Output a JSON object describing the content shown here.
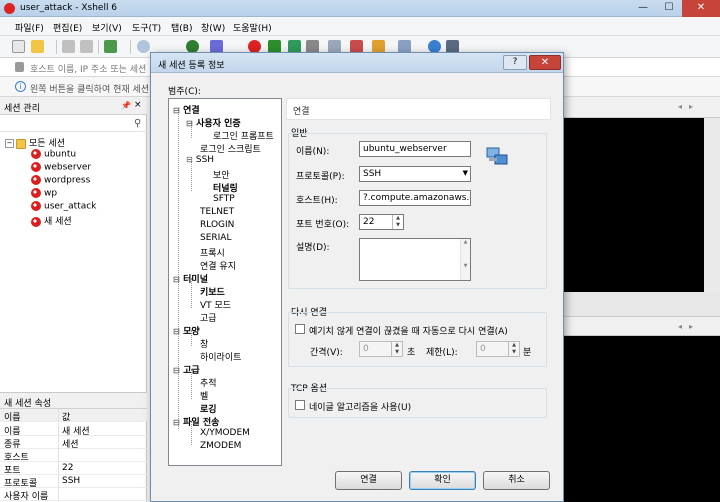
{
  "window": {
    "title": "user_attack - Xshell 6",
    "min_glyph": "—",
    "max_glyph": "☐",
    "close_glyph": "✕"
  },
  "menu": [
    "파일(F)",
    "편집(E)",
    "보기(V)",
    "도구(T)",
    "탭(B)",
    "창(W)",
    "도움말(H)"
  ],
  "address": {
    "placeholder": "호스트 이름, IP 주소 또는 세션"
  },
  "hint": {
    "text": "왼쪽 버튼을 클릭하여 현재 세션"
  },
  "session_panel": {
    "title": "세션 관리",
    "pin_glyph": "📌",
    "close_glyph": "×",
    "root": "모든 세션",
    "expander": "−",
    "items": [
      "ubuntu",
      "webserver",
      "wordpress",
      "wp",
      "user_attack",
      "새 세션"
    ]
  },
  "properties": {
    "title": "새 세션 속성",
    "header": {
      "key": "이름",
      "value": "값"
    },
    "rows": [
      {
        "key": "이름",
        "value": "새 세션"
      },
      {
        "key": "종류",
        "value": "세션"
      },
      {
        "key": "호스트",
        "value": ""
      },
      {
        "key": "포트",
        "value": "22"
      },
      {
        "key": "프로토콜",
        "value": "SSH"
      },
      {
        "key": "사용자 이름",
        "value": ""
      }
    ]
  },
  "tab_arrows": {
    "left": "◂",
    "right": "▸"
  },
  "dialog": {
    "title": "새 세션 등록 정보",
    "help": "?",
    "close": "✕",
    "category_label": "범주(C):",
    "categories": [
      {
        "id": "connection",
        "label": "연결",
        "bold": true,
        "mark": "⊟"
      },
      {
        "id": "user-auth",
        "label": "사용자 인증",
        "bold": true,
        "mark": "⊟"
      },
      {
        "id": "login-prompt",
        "label": "로그인 프롬프트"
      },
      {
        "id": "login-script",
        "label": "로그인 스크립트"
      },
      {
        "id": "ssh",
        "label": "SSH",
        "mark": "⊟"
      },
      {
        "id": "security",
        "label": "보안"
      },
      {
        "id": "tunneling",
        "label": "터널링",
        "bold": true
      },
      {
        "id": "sftp",
        "label": "SFTP"
      },
      {
        "id": "telnet",
        "label": "TELNET"
      },
      {
        "id": "rlogin",
        "label": "RLOGIN"
      },
      {
        "id": "serial",
        "label": "SERIAL"
      },
      {
        "id": "proxy",
        "label": "프록시"
      },
      {
        "id": "keepalive",
        "label": "연결 유지"
      },
      {
        "id": "terminal",
        "label": "터미널",
        "bold": true,
        "mark": "⊟"
      },
      {
        "id": "keyboard",
        "label": "키보드",
        "bold": true
      },
      {
        "id": "vt-mode",
        "label": "VT 모드"
      },
      {
        "id": "advanced-t",
        "label": "고급"
      },
      {
        "id": "appearance",
        "label": "모양",
        "bold": true,
        "mark": "⊟"
      },
      {
        "id": "window",
        "label": "창"
      },
      {
        "id": "highlight",
        "label": "하이라이트"
      },
      {
        "id": "advanced",
        "label": "고급",
        "bold": true,
        "mark": "⊟"
      },
      {
        "id": "trace",
        "label": "추적"
      },
      {
        "id": "bell",
        "label": "벨"
      },
      {
        "id": "logging",
        "label": "로깅",
        "bold": true
      },
      {
        "id": "file-transfer",
        "label": "파일 전송",
        "bold": true,
        "mark": "⊟"
      },
      {
        "id": "xymodem",
        "label": "X/YMODEM"
      },
      {
        "id": "zmodem",
        "label": "ZMODEM"
      }
    ],
    "content_header": "연결",
    "general": {
      "title": "일반",
      "name_label": "이름(N):",
      "name_value": "ubuntu_webserver",
      "protocol_label": "프로토콜(P):",
      "protocol_value": "SSH",
      "host_label": "호스트(H):",
      "host_value": "?.compute.amazonaws.com",
      "port_label": "포트 번호(O):",
      "port_value": "22",
      "desc_label": "설명(D):",
      "desc_value": ""
    },
    "reconnect": {
      "title": "다시 연결",
      "checkbox_label": "예기치 않게 연결이 끊겼을 때 자동으로 다시 연결(A)",
      "interval_label": "간격(V):",
      "interval_value": "0",
      "interval_unit": "초",
      "limit_label": "제한(L):",
      "limit_value": "0",
      "limit_unit": "분"
    },
    "tcp": {
      "title": "TCP 옵션",
      "checkbox_label": "네이글 알고리즘을 사용(U)"
    },
    "buttons": {
      "connect": "연결",
      "ok": "확인",
      "cancel": "취소"
    }
  }
}
